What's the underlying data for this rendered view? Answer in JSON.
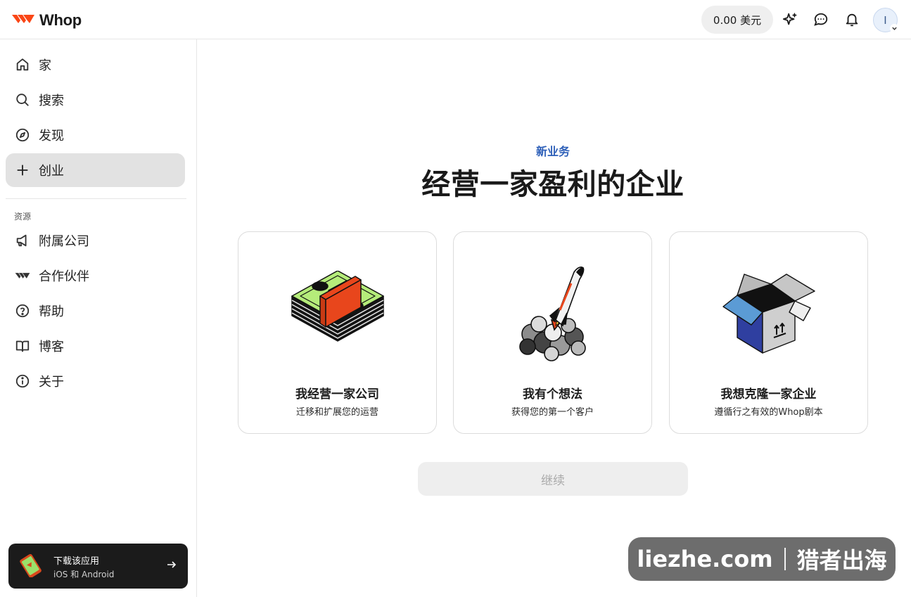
{
  "header": {
    "logo_text": "Whop",
    "balance": "0.00 美元",
    "avatar_initial": "I",
    "icons": [
      "sparkle-icon",
      "chat-icon",
      "bell-icon"
    ]
  },
  "sidebar": {
    "items": [
      {
        "label": "家",
        "icon": "home-icon"
      },
      {
        "label": "搜索",
        "icon": "search-icon"
      },
      {
        "label": "发现",
        "icon": "compass-icon"
      },
      {
        "label": "创业",
        "icon": "plus-icon",
        "active": true
      }
    ],
    "section_label": "资源",
    "resource_items": [
      {
        "label": "附属公司",
        "icon": "megaphone-icon"
      },
      {
        "label": "合作伙伴",
        "icon": "whop-logo-icon"
      },
      {
        "label": "帮助",
        "icon": "help-icon"
      },
      {
        "label": "博客",
        "icon": "book-icon"
      },
      {
        "label": "关于",
        "icon": "info-icon"
      }
    ],
    "app_banner": {
      "title": "下载该应用",
      "subtitle": "iOS 和 Android"
    }
  },
  "main": {
    "kicker": "新业务",
    "headline": "经营一家盈利的企业",
    "cards": [
      {
        "title": "我经营一家公司",
        "subtitle": "迁移和扩展您的运营",
        "illustration": "money-stack-icon"
      },
      {
        "title": "我有个想法",
        "subtitle": "获得您的第一个客户",
        "illustration": "rocket-icon"
      },
      {
        "title": "我想克隆一家企业",
        "subtitle": "遵循行之有效的Whop剧本",
        "illustration": "box-icon"
      }
    ],
    "continue_label": "继续"
  },
  "watermark": {
    "left": "liezhe.com",
    "right": "猎者出海"
  },
  "colors": {
    "accent_blue": "#2d5fb8",
    "brand_orange": "#fa4616",
    "active_nav_bg": "#e2e2e2"
  }
}
